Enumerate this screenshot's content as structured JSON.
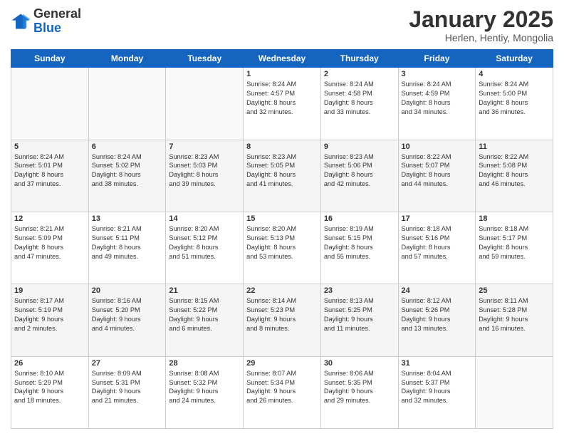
{
  "logo": {
    "general": "General",
    "blue": "Blue"
  },
  "title": "January 2025",
  "location": "Herlen, Hentiy, Mongolia",
  "days_of_week": [
    "Sunday",
    "Monday",
    "Tuesday",
    "Wednesday",
    "Thursday",
    "Friday",
    "Saturday"
  ],
  "weeks": [
    [
      {
        "day": "",
        "info": ""
      },
      {
        "day": "",
        "info": ""
      },
      {
        "day": "",
        "info": ""
      },
      {
        "day": "1",
        "info": "Sunrise: 8:24 AM\nSunset: 4:57 PM\nDaylight: 8 hours\nand 32 minutes."
      },
      {
        "day": "2",
        "info": "Sunrise: 8:24 AM\nSunset: 4:58 PM\nDaylight: 8 hours\nand 33 minutes."
      },
      {
        "day": "3",
        "info": "Sunrise: 8:24 AM\nSunset: 4:59 PM\nDaylight: 8 hours\nand 34 minutes."
      },
      {
        "day": "4",
        "info": "Sunrise: 8:24 AM\nSunset: 5:00 PM\nDaylight: 8 hours\nand 36 minutes."
      }
    ],
    [
      {
        "day": "5",
        "info": "Sunrise: 8:24 AM\nSunset: 5:01 PM\nDaylight: 8 hours\nand 37 minutes."
      },
      {
        "day": "6",
        "info": "Sunrise: 8:24 AM\nSunset: 5:02 PM\nDaylight: 8 hours\nand 38 minutes."
      },
      {
        "day": "7",
        "info": "Sunrise: 8:23 AM\nSunset: 5:03 PM\nDaylight: 8 hours\nand 39 minutes."
      },
      {
        "day": "8",
        "info": "Sunrise: 8:23 AM\nSunset: 5:05 PM\nDaylight: 8 hours\nand 41 minutes."
      },
      {
        "day": "9",
        "info": "Sunrise: 8:23 AM\nSunset: 5:06 PM\nDaylight: 8 hours\nand 42 minutes."
      },
      {
        "day": "10",
        "info": "Sunrise: 8:22 AM\nSunset: 5:07 PM\nDaylight: 8 hours\nand 44 minutes."
      },
      {
        "day": "11",
        "info": "Sunrise: 8:22 AM\nSunset: 5:08 PM\nDaylight: 8 hours\nand 46 minutes."
      }
    ],
    [
      {
        "day": "12",
        "info": "Sunrise: 8:21 AM\nSunset: 5:09 PM\nDaylight: 8 hours\nand 47 minutes."
      },
      {
        "day": "13",
        "info": "Sunrise: 8:21 AM\nSunset: 5:11 PM\nDaylight: 8 hours\nand 49 minutes."
      },
      {
        "day": "14",
        "info": "Sunrise: 8:20 AM\nSunset: 5:12 PM\nDaylight: 8 hours\nand 51 minutes."
      },
      {
        "day": "15",
        "info": "Sunrise: 8:20 AM\nSunset: 5:13 PM\nDaylight: 8 hours\nand 53 minutes."
      },
      {
        "day": "16",
        "info": "Sunrise: 8:19 AM\nSunset: 5:15 PM\nDaylight: 8 hours\nand 55 minutes."
      },
      {
        "day": "17",
        "info": "Sunrise: 8:18 AM\nSunset: 5:16 PM\nDaylight: 8 hours\nand 57 minutes."
      },
      {
        "day": "18",
        "info": "Sunrise: 8:18 AM\nSunset: 5:17 PM\nDaylight: 8 hours\nand 59 minutes."
      }
    ],
    [
      {
        "day": "19",
        "info": "Sunrise: 8:17 AM\nSunset: 5:19 PM\nDaylight: 9 hours\nand 2 minutes."
      },
      {
        "day": "20",
        "info": "Sunrise: 8:16 AM\nSunset: 5:20 PM\nDaylight: 9 hours\nand 4 minutes."
      },
      {
        "day": "21",
        "info": "Sunrise: 8:15 AM\nSunset: 5:22 PM\nDaylight: 9 hours\nand 6 minutes."
      },
      {
        "day": "22",
        "info": "Sunrise: 8:14 AM\nSunset: 5:23 PM\nDaylight: 9 hours\nand 8 minutes."
      },
      {
        "day": "23",
        "info": "Sunrise: 8:13 AM\nSunset: 5:25 PM\nDaylight: 9 hours\nand 11 minutes."
      },
      {
        "day": "24",
        "info": "Sunrise: 8:12 AM\nSunset: 5:26 PM\nDaylight: 9 hours\nand 13 minutes."
      },
      {
        "day": "25",
        "info": "Sunrise: 8:11 AM\nSunset: 5:28 PM\nDaylight: 9 hours\nand 16 minutes."
      }
    ],
    [
      {
        "day": "26",
        "info": "Sunrise: 8:10 AM\nSunset: 5:29 PM\nDaylight: 9 hours\nand 18 minutes."
      },
      {
        "day": "27",
        "info": "Sunrise: 8:09 AM\nSunset: 5:31 PM\nDaylight: 9 hours\nand 21 minutes."
      },
      {
        "day": "28",
        "info": "Sunrise: 8:08 AM\nSunset: 5:32 PM\nDaylight: 9 hours\nand 24 minutes."
      },
      {
        "day": "29",
        "info": "Sunrise: 8:07 AM\nSunset: 5:34 PM\nDaylight: 9 hours\nand 26 minutes."
      },
      {
        "day": "30",
        "info": "Sunrise: 8:06 AM\nSunset: 5:35 PM\nDaylight: 9 hours\nand 29 minutes."
      },
      {
        "day": "31",
        "info": "Sunrise: 8:04 AM\nSunset: 5:37 PM\nDaylight: 9 hours\nand 32 minutes."
      },
      {
        "day": "",
        "info": ""
      }
    ]
  ]
}
